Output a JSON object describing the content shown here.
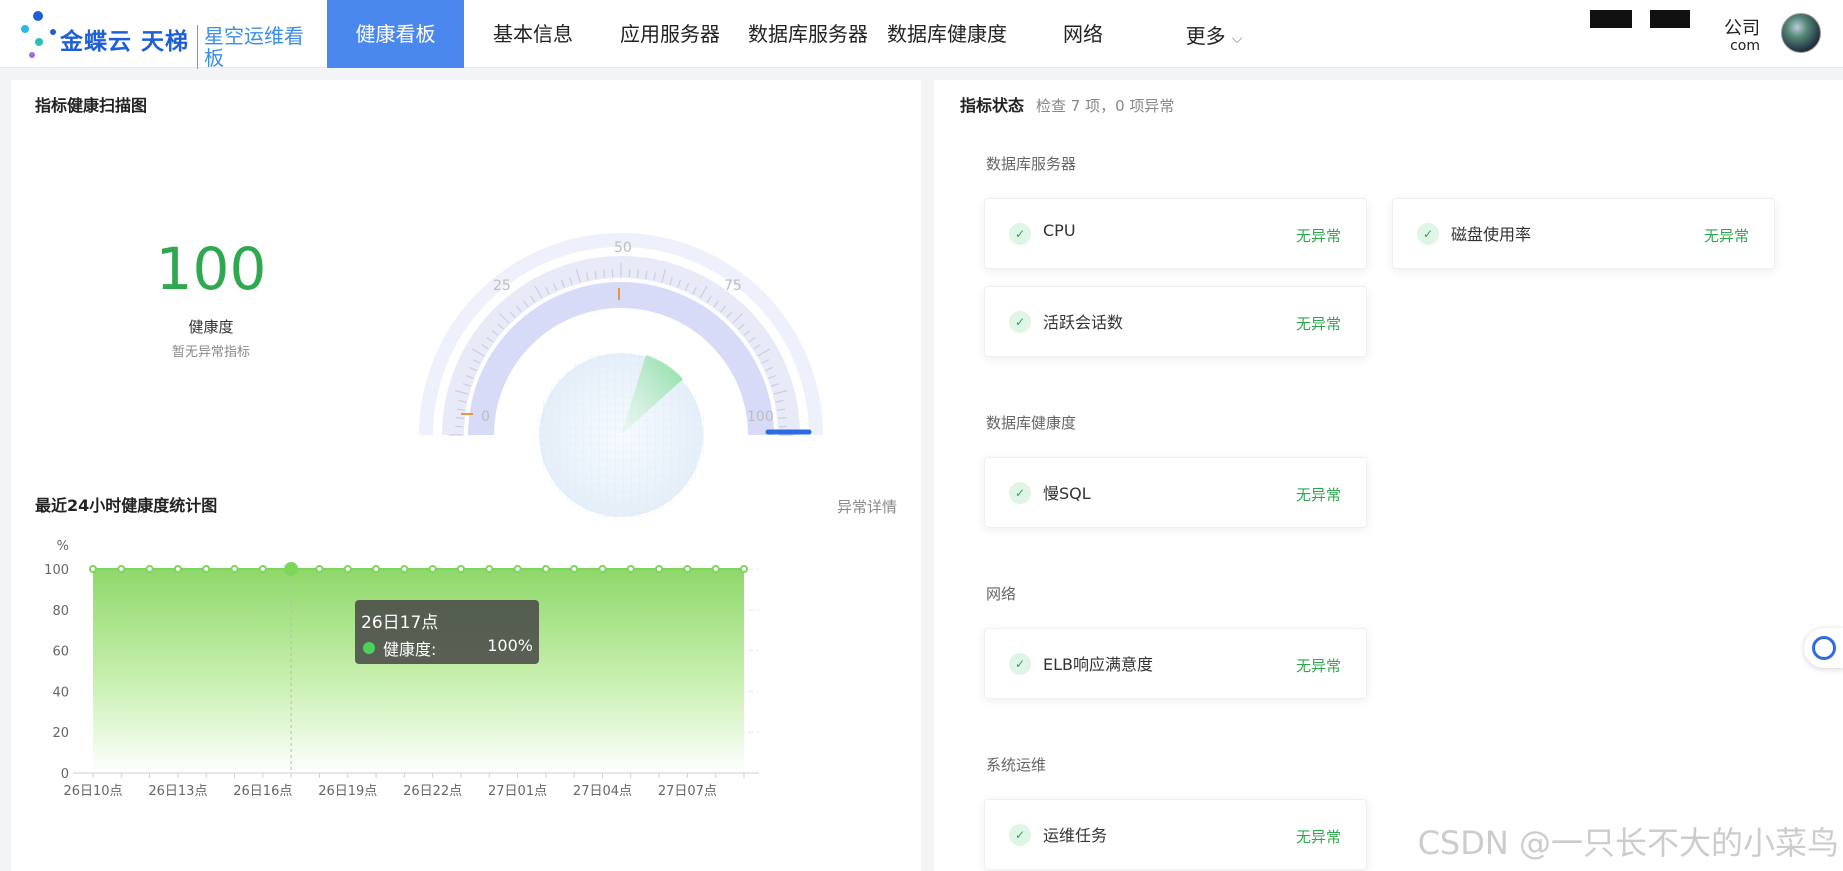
{
  "nav": {
    "brand": "金蝶云 天梯",
    "product": "星空运维看板",
    "tabs": [
      {
        "label": "健康看板",
        "active": true
      },
      {
        "label": "基本信息",
        "active": false
      },
      {
        "label": "应用服务器",
        "active": false
      },
      {
        "label": "数据库服务器",
        "active": false
      },
      {
        "label": "数据库健康度",
        "active": false
      },
      {
        "label": "网络",
        "active": false
      },
      {
        "label": "更多",
        "active": false
      }
    ],
    "company_text": "公司",
    "company_url": "com",
    "accent_color": "#4a88ee"
  },
  "health_panel": {
    "title": "指标健康扫描图",
    "score": "100",
    "score_label": "健康度",
    "score_sub": "暂无异常指标",
    "score_color": "#2fa84f",
    "gauge": {
      "value": 100,
      "ticks": [
        "0",
        "25",
        "50",
        "75",
        "100"
      ]
    }
  },
  "trend_panel": {
    "title": "最近24小时健康度统计图",
    "link": "异常详情",
    "tooltip": {
      "title": "26日17点",
      "label": "健康度:",
      "value": "100%"
    }
  },
  "chart_data": {
    "type": "area",
    "title": "最近24小时健康度统计图",
    "ylabel": "%",
    "ylim": [
      0,
      100
    ],
    "yticks": [
      "0",
      "20",
      "40",
      "60",
      "80",
      "100"
    ],
    "x_tick_labels": [
      "26日10点",
      "26日13点",
      "26日16点",
      "26日19点",
      "26日22点",
      "27日01点",
      "27日04点",
      "27日07点"
    ],
    "x": [
      "26日10点",
      "26日11点",
      "26日12点",
      "26日13点",
      "26日14点",
      "26日15点",
      "26日16点",
      "26日17点",
      "26日18点",
      "26日19点",
      "26日20点",
      "26日21点",
      "26日22点",
      "26日23点",
      "27日00点",
      "27日01点",
      "27日02点",
      "27日03点",
      "27日04点",
      "27日05点",
      "27日06点",
      "27日07点",
      "27日08点",
      "27日09点"
    ],
    "series": [
      {
        "name": "健康度",
        "values": [
          100,
          100,
          100,
          100,
          100,
          100,
          100,
          100,
          100,
          100,
          100,
          100,
          100,
          100,
          100,
          100,
          100,
          100,
          100,
          100,
          100,
          100,
          100,
          100
        ]
      }
    ],
    "highlighted_point": "26日17点",
    "color": "#7dd55c",
    "grid": true
  },
  "status_panel": {
    "title": "指标状态",
    "summary": "检查 7 项，0 项异常",
    "groups": [
      {
        "label": "数据库服务器",
        "items": [
          {
            "name": "CPU",
            "status": "无异常"
          },
          {
            "name": "磁盘使用率",
            "status": "无异常"
          },
          {
            "name": "活跃会话数",
            "status": "无异常"
          }
        ]
      },
      {
        "label": "数据库健康度",
        "items": [
          {
            "name": "慢SQL",
            "status": "无异常"
          }
        ]
      },
      {
        "label": "网络",
        "items": [
          {
            "name": "ELB响应满意度",
            "status": "无异常"
          }
        ]
      },
      {
        "label": "系统运维",
        "items": [
          {
            "name": "运维任务",
            "status": "无异常"
          }
        ]
      }
    ],
    "ok_color": "#2fa84f"
  },
  "watermark": "CSDN @一只长不大的小菜鸟"
}
